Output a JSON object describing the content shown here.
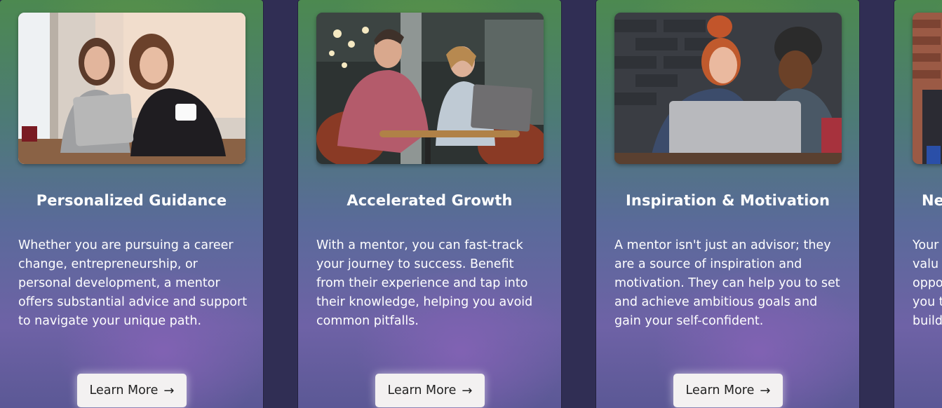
{
  "cards": [
    {
      "title": "Personalized Guidance",
      "description": "Whether you are pursuing a career change, entrepreneurship, or personal development, a mentor offers substantial advice and support to navigate your unique path.",
      "button_label": "Learn More",
      "button_icon": "arrow-right-icon",
      "arrow": "→",
      "image_alt": "Two women smiling at a tablet in a cafe"
    },
    {
      "title": "Accelerated Growth",
      "description": "With a mentor, you can fast-track your journey to success. Benefit from their experience and tap into their knowledge, helping you avoid common pitfalls.",
      "button_label": "Learn More",
      "button_icon": "arrow-right-icon",
      "arrow": "→",
      "image_alt": "Man and woman working on a laptop at a table"
    },
    {
      "title": "Inspiration & Motivation",
      "description": "A mentor isn't just an advisor; they are a source of inspiration and motivation. They can help you to set and achieve ambitious goals and gain your self-confident.",
      "button_label": "Learn More",
      "button_icon": "arrow-right-icon",
      "arrow": "→",
      "image_alt": "Two people laughing in front of a laptop"
    },
    {
      "title": "Ne",
      "description": "Your valu oppo you t build",
      "button_label": "",
      "image_alt": "Partially visible card photo"
    }
  ],
  "colors": {
    "page_background": "#302e54",
    "card_top_green": "#4c8950",
    "card_bottom_purple": "#6e62a6",
    "button_background": "#f3f1f1",
    "text": "#ffffff"
  }
}
